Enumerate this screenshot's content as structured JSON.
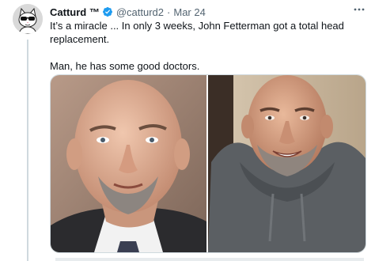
{
  "tweet": {
    "display_name": "Catturd ™",
    "handle": "@catturd2",
    "separator": "·",
    "date": "Mar 24",
    "more_icon": "more-horizontal-icon",
    "verified_icon": "verified-badge-icon",
    "paragraphs": [
      "It’s a miracle ... In only 3 weeks, John Fetterman got a total head replacement.",
      "Man, he has some good doctors."
    ],
    "media": [
      {
        "icon": "photo-before"
      },
      {
        "icon": "photo-after"
      }
    ]
  },
  "colors": {
    "text_primary": "#0f1419",
    "text_secondary": "#536471",
    "verified_blue": "#1d9bf0",
    "thread_line": "#cfd9de"
  }
}
